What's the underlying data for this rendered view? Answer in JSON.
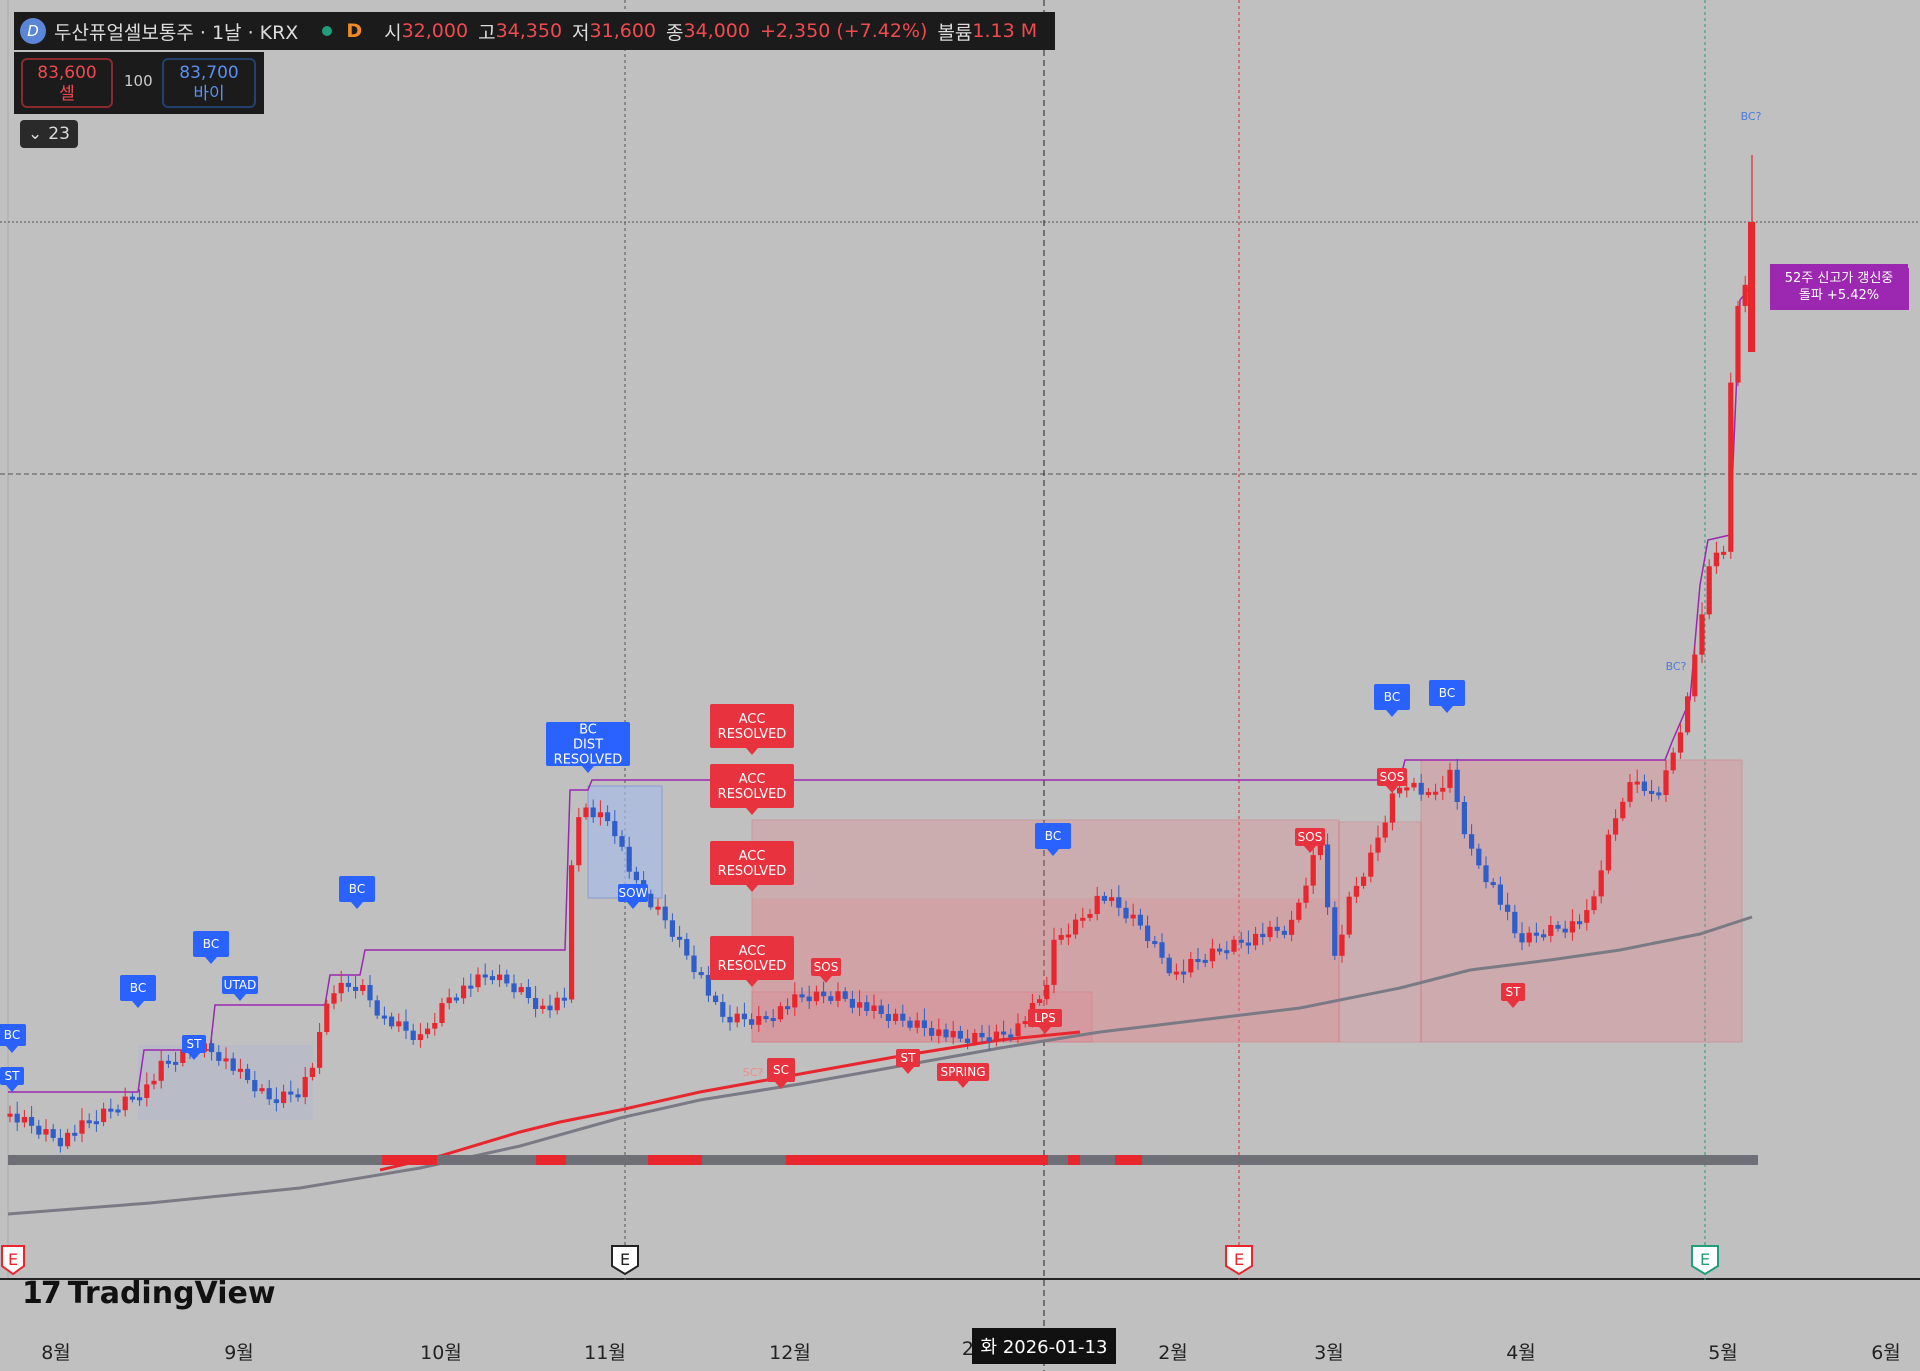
{
  "header": {
    "symbol": "두산퓨얼셀보통주 · 1날 · KRX",
    "interval_code": "D",
    "open_label": "시",
    "open": "32,000",
    "high_label": "고",
    "high": "34,350",
    "low_label": "저",
    "low": "31,600",
    "close_label": "종",
    "close": "34,000",
    "change": "+2,350 (+7.42%)",
    "volume_label": "볼륨",
    "volume": "1.13 M"
  },
  "trade": {
    "sell_price": "83,600",
    "sell_label": "셀",
    "quantity": "100",
    "buy_price": "83,700",
    "buy_label": "바이"
  },
  "indicators_toggle": {
    "count": "23"
  },
  "watermark": "TradingView",
  "crosshair_label": "화 2026-01-13",
  "colors": {
    "up": "#e8262e",
    "down": "#2f5ec8",
    "bg": "#c0c0c0",
    "purple": "#9c27b0",
    "ma": "#7a7a85"
  },
  "chart_data": {
    "type": "candlestick",
    "x_ticks": [
      "8월",
      "9월",
      "10월",
      "11월",
      "12월",
      "20",
      "2월",
      "3월",
      "4월",
      "5월",
      "6월"
    ],
    "price_start": 31600,
    "price_end": 34000,
    "annotations": [
      "BC",
      "BC",
      "BC",
      "BC",
      "BC",
      "BC",
      "BC",
      "BC DIST RESOLVED",
      "ACC RESOLVED",
      "ACC RESOLVED",
      "ACC RESOLVED",
      "ACC RESOLVED",
      "SC",
      "ST",
      "ST",
      "ST",
      "UTAD",
      "SPRING",
      "LPS",
      "SOW",
      "SOS",
      "SOS",
      "SOS",
      "ST",
      "SC?",
      "BC?",
      "BC?"
    ],
    "callout": "52주 신고가 갱신중 돌파 +5.42%",
    "event_markers": [
      "E",
      "E",
      "E",
      "E"
    ]
  }
}
